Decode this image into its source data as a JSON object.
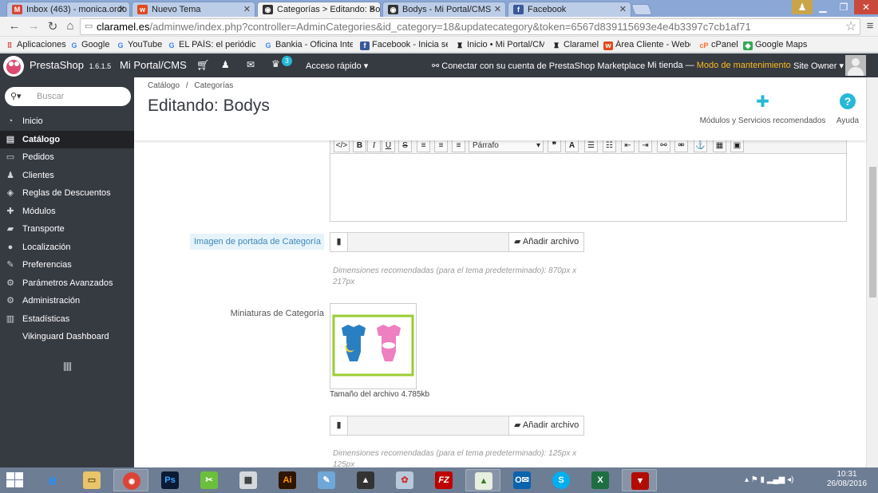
{
  "browser": {
    "tabs": [
      {
        "label": "Inbox (463) - monica.ordo",
        "icon": "gmail-icon"
      },
      {
        "label": "Nuevo Tema",
        "icon": "wix-icon"
      },
      {
        "label": "Categorías > Editando: Bo",
        "icon": "prestashop-icon"
      },
      {
        "label": "Bodys - Mi Portal/CMS",
        "icon": "prestashop-icon"
      },
      {
        "label": "Facebook",
        "icon": "facebook-icon"
      }
    ],
    "url_domain": "claramel.es",
    "url_path": "/adminwe/index.php?controller=AdminCategories&id_category=18&updatecategory&token=6567d839115693e4e4b3397c7cb1af71",
    "bookmarks": [
      "Aplicaciones",
      "Google",
      "YouTube",
      "EL PAÍS: el periódico g",
      "Bankia - Oficina Intern",
      "Facebook - Inicia sesió",
      "Inicio • Mi Portal/CMS",
      "Claramel",
      "Área Cliente - Webem",
      "cPanel",
      "Google Maps"
    ]
  },
  "header": {
    "brand": "PrestaShop",
    "version": "1.6.1.5",
    "shop_name": "Mi Portal/CMS",
    "notification_count": "3",
    "quick_access": "Acceso rápido",
    "marketplace": "Conectar con su cuenta de PrestaShop Marketplace",
    "my_shop": "Mi tienda",
    "dash": "—",
    "maintenance": "Modo de mantenimiento",
    "user": "Site Owner"
  },
  "sidebar": {
    "search_placeholder": "Buscar",
    "items": [
      {
        "label": "Inicio",
        "icon": "dashboard-icon"
      },
      {
        "label": "Catálogo",
        "icon": "catalog-icon",
        "active": true
      },
      {
        "label": "Pedidos",
        "icon": "orders-icon"
      },
      {
        "label": "Clientes",
        "icon": "customers-icon"
      },
      {
        "label": "Reglas de Descuentos",
        "icon": "discount-icon"
      },
      {
        "label": "Módulos",
        "icon": "modules-icon"
      },
      {
        "label": "Transporte",
        "icon": "truck-icon"
      },
      {
        "label": "Localización",
        "icon": "globe-icon"
      },
      {
        "label": "Preferencias",
        "icon": "wrench-icon"
      },
      {
        "label": "Parámetros Avanzados",
        "icon": "cogs-icon"
      },
      {
        "label": "Administración",
        "icon": "gear-icon"
      },
      {
        "label": "Estadísticas",
        "icon": "stats-icon"
      },
      {
        "label": "Vikinguard Dashboard",
        "icon": ""
      }
    ]
  },
  "page": {
    "breadcrumb_1": "Catálogo",
    "breadcrumb_sep": "/",
    "breadcrumb_2": "Categorías",
    "title": "Editando: Bodys",
    "modules_label": "Módulos y Servicios recomendados",
    "help_label": "Ayuda"
  },
  "editor": {
    "format_value": "Párrafo"
  },
  "form": {
    "cover_label": "Imagen de portada de Categoría",
    "add_file": "Añadir archivo",
    "cover_hint": "Dimensiones recomendadas (para el tema predeterminado): 870px x 217px",
    "thumb_label": "Miniaturas de Categoría",
    "file_size": "Tamaño del archivo 4.785kb",
    "thumb_hint": "Dimensiones recomendadas (para el tema predeterminado): 125px x 125px"
  },
  "taskbar": {
    "time": "10:31",
    "date": "26/08/2016"
  },
  "colors": {
    "ps_dark": "#363a41",
    "ps_blue": "#25b9d7",
    "maintenance": "#fbbb22",
    "highlight_label_bg": "#e6f3fa"
  }
}
